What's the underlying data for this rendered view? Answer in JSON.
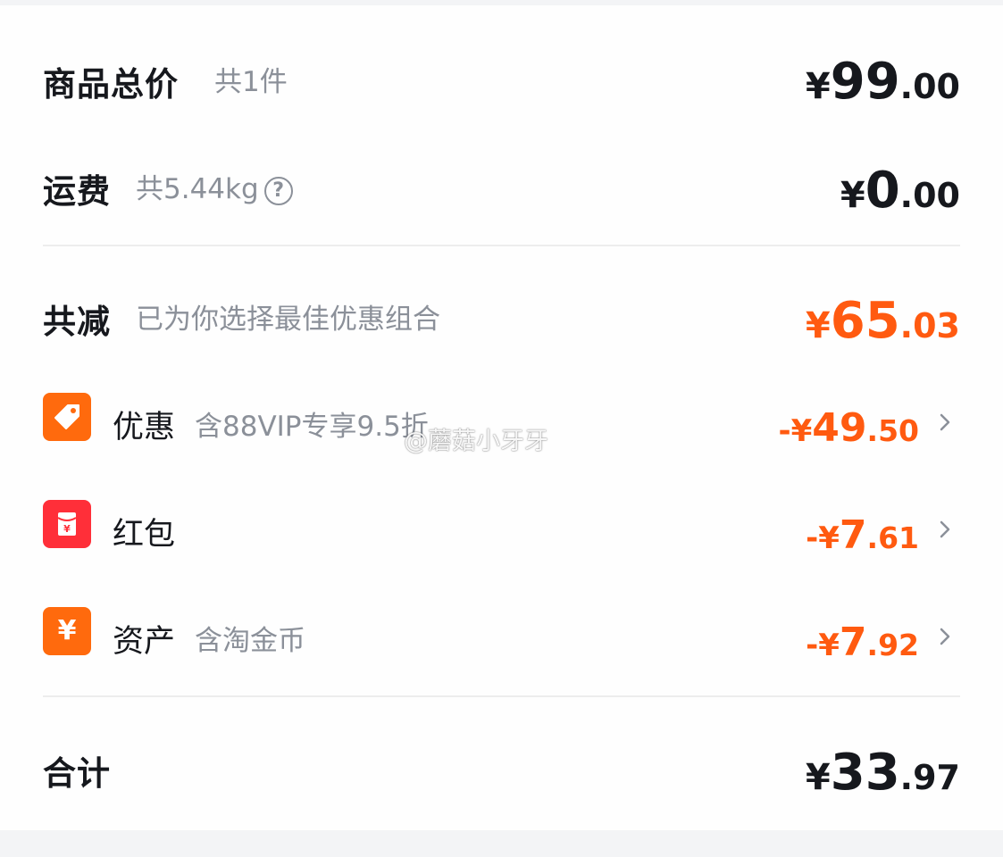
{
  "summary": {
    "goods_total": {
      "label": "商品总价",
      "sub": "共1件",
      "symbol": "¥",
      "int": "99",
      "dec": ".00"
    },
    "shipping": {
      "label": "运费",
      "sub": "共5.44kg",
      "help_icon": "question-circle-icon",
      "symbol": "¥",
      "int": "0",
      "dec": ".00"
    },
    "reduction": {
      "label": "共减",
      "sub": "已为你选择最佳优惠组合",
      "symbol": "¥",
      "int": "65",
      "dec": ".03"
    }
  },
  "discounts": [
    {
      "icon": "coupon-tag-icon",
      "label": "优惠",
      "sub": "含88VIP专享9.5折",
      "prefix": "-¥",
      "int": "49",
      "dec": ".50"
    },
    {
      "icon": "red-packet-icon",
      "label": "红包",
      "sub": "",
      "prefix": "-¥",
      "int": "7",
      "dec": ".61"
    },
    {
      "icon": "yen-asset-icon",
      "label": "资产",
      "sub": "含淘金币",
      "prefix": "-¥",
      "int": "7",
      "dec": ".92"
    }
  ],
  "total": {
    "label": "合计",
    "symbol": "¥",
    "int": "33",
    "dec": ".97"
  },
  "watermark": "@蘑菇小牙牙",
  "colors": {
    "accent": "#ff5a10",
    "text": "#16181d",
    "muted": "#8b9099",
    "badge_orange": "#ff6a0d",
    "badge_red": "#ff2f39"
  }
}
